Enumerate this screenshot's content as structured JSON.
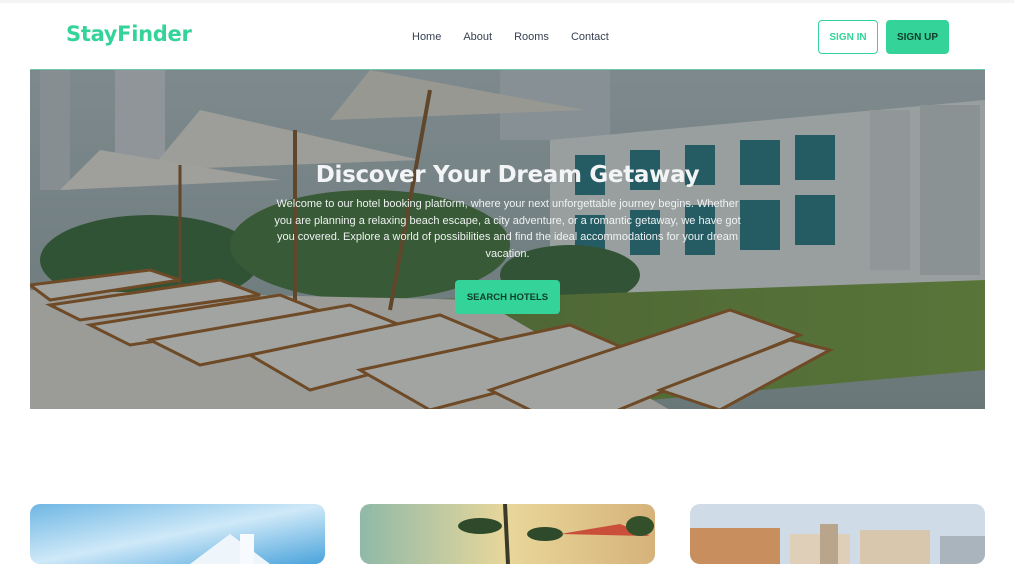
{
  "header": {
    "logo": "StayFinder",
    "nav": [
      "Home",
      "About",
      "Rooms",
      "Contact"
    ],
    "sign_in": "SIGN IN",
    "sign_up": "SIGN UP",
    "accent_color": "#34d399"
  },
  "hero": {
    "title": "Discover Your Dream Getaway",
    "text": "Welcome to our hotel booking platform, where your next unforgettable journey begins. Whether you are planning a relaxing beach escape, a city adventure, or a romantic getaway, we have got you covered. Explore a world of possibilities and find the ideal accommodations for your dream vacation.",
    "button": "SEARCH HOTELS",
    "background_image": "poolside-loungers-photo"
  },
  "cards": [
    {
      "image": "hotel-sky-photo"
    },
    {
      "image": "palm-beach-sunset-photo"
    },
    {
      "image": "seaside-town-photo"
    }
  ]
}
